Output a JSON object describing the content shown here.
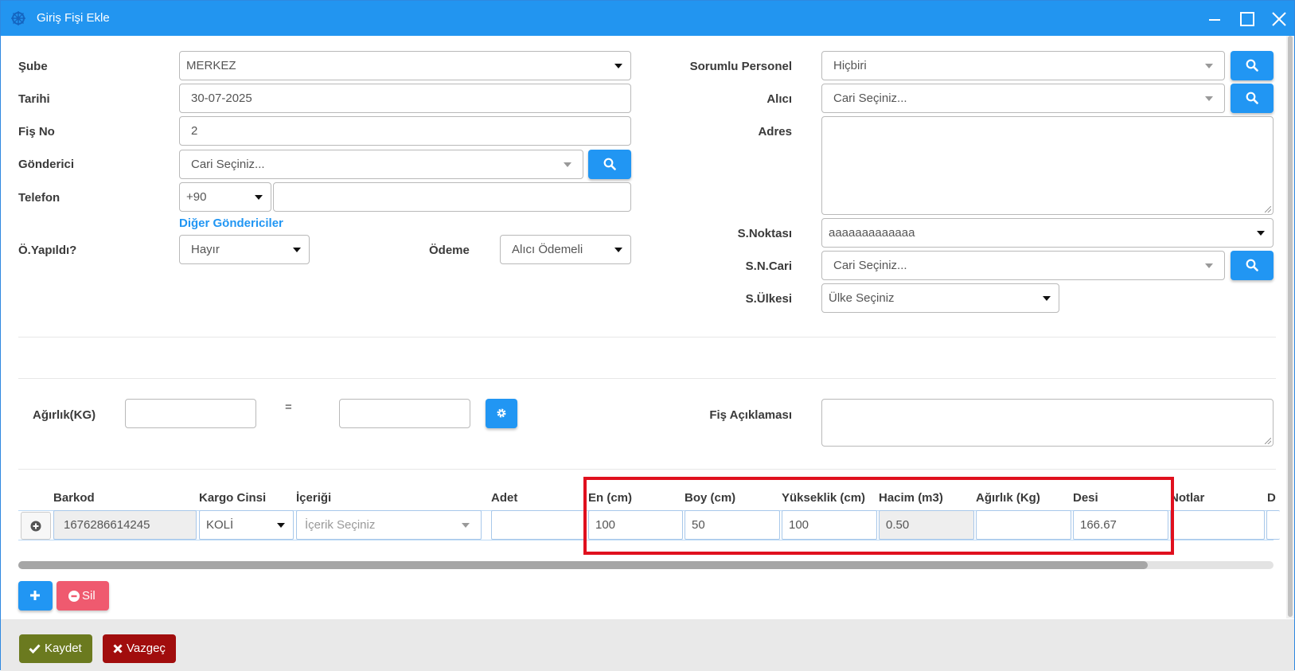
{
  "window": {
    "title": "Giriş Fişi Ekle"
  },
  "form": {
    "sube": {
      "label": "Şube",
      "value": "MERKEZ"
    },
    "tarih": {
      "label": "Tarihi",
      "value": "30-07-2025"
    },
    "fis_no": {
      "label": "Fiş No",
      "value": "2"
    },
    "gonderici": {
      "label": "Gönderici",
      "placeholder": "Cari Seçiniz..."
    },
    "telefon": {
      "label": "Telefon",
      "code": "+90",
      "value": ""
    },
    "diger_link": "Diğer Göndericiler",
    "o_yapildi": {
      "label": "Ö.Yapıldı?",
      "value": "Hayır"
    },
    "odeme": {
      "label": "Ödeme",
      "value": "Alıcı Ödemeli"
    },
    "sorumlu": {
      "label": "Sorumlu Personel",
      "value": "Hiçbiri"
    },
    "alici": {
      "label": "Alıcı",
      "placeholder": "Cari Seçiniz..."
    },
    "adres": {
      "label": "Adres",
      "value": ""
    },
    "s_noktasi": {
      "label": "S.Noktası",
      "value": "aaaaaaaaaaaaa"
    },
    "sn_cari": {
      "label": "S.N.Cari",
      "placeholder": "Cari Seçiniz..."
    },
    "s_ulkesi": {
      "label": "S.Ülkesi",
      "value": "Ülke Seçiniz"
    },
    "agirlik": {
      "label": "Ağırlık(KG)",
      "equals": "=",
      "value1": "",
      "value2": ""
    },
    "fis_aciklamasi": {
      "label": "Fiş Açıklaması",
      "value": ""
    }
  },
  "grid": {
    "headers": [
      "Barkod",
      "Kargo Cinsi",
      "İçeriği",
      "Adet",
      "En (cm)",
      "Boy (cm)",
      "Yükseklik (cm)",
      "Hacim (m3)",
      "Ağırlık (Kg)",
      "Desi",
      "Notlar",
      "D"
    ],
    "row": {
      "barkod": "1676286614245",
      "kargo_cinsi": "KOLİ",
      "icerigi": "İçerik Seçiniz",
      "adet": "",
      "en": "100",
      "boy": "50",
      "yukseklik": "100",
      "hacim": "0.50",
      "agirlik": "",
      "desi": "166.67",
      "notlar": ""
    },
    "scroll_fraction": 0.9
  },
  "buttons": {
    "sil": "Sil",
    "kaydet": "Kaydet",
    "vazgec": "Vazgeç"
  },
  "colors": {
    "titlebar": "#2295f0",
    "primary": "#2196f3",
    "danger_light": "#ef5a6f",
    "success": "#6b7a1f",
    "danger": "#a10d0d",
    "highlight": "#e0101e"
  }
}
